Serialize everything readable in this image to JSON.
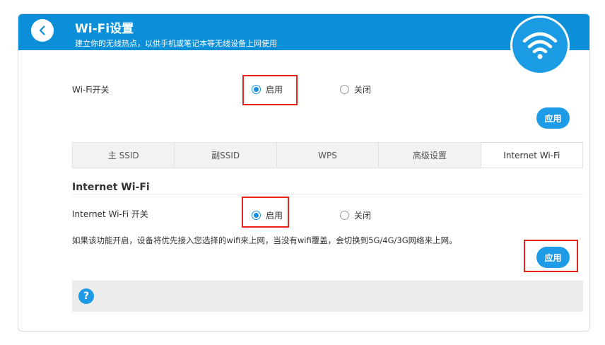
{
  "header": {
    "title": "Wi-Fi设置",
    "subtitle": "建立你的无线热点，以供手机或笔记本等无线设备上网使用",
    "back_icon": "chevron-left-icon",
    "badge_icon": "wifi-icon"
  },
  "wifi_switch": {
    "label": "Wi-Fi开关",
    "options": [
      {
        "label": "启用",
        "checked": true
      },
      {
        "label": "关闭",
        "checked": false
      }
    ],
    "apply_label": "应用"
  },
  "tabs": [
    {
      "label": "主 SSID",
      "active": false
    },
    {
      "label": "副SSID",
      "active": false
    },
    {
      "label": "WPS",
      "active": false
    },
    {
      "label": "高级设置",
      "active": false
    },
    {
      "label": "Internet Wi-Fi",
      "active": true
    }
  ],
  "internet_wifi": {
    "section_title": "Internet Wi-Fi",
    "switch_label": "Internet Wi-Fi 开关",
    "options": [
      {
        "label": "启用",
        "checked": true
      },
      {
        "label": "关闭",
        "checked": false
      }
    ],
    "description": "如果该功能开启，设备将优先接入您选择的wifi来上网，当没有wifi覆盖，会切换到5G/4G/3G网络来上网。",
    "apply_label": "应用"
  },
  "help": {
    "icon_text": "?"
  },
  "colors": {
    "primary": "#0b8fd8",
    "button": "#1e9be6",
    "highlight": "#e8231e"
  }
}
